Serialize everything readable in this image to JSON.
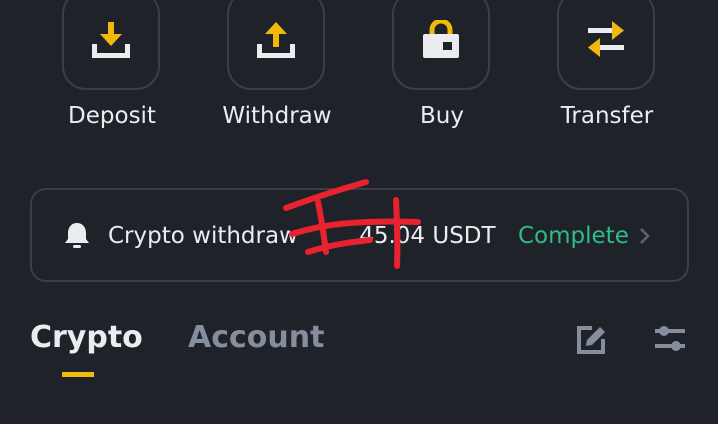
{
  "actions": [
    {
      "label": "Deposit",
      "icon": "deposit-icon"
    },
    {
      "label": "Withdraw",
      "icon": "withdraw-icon"
    },
    {
      "label": "Buy",
      "icon": "buy-icon"
    },
    {
      "label": "Transfer",
      "icon": "transfer-icon"
    }
  ],
  "notice": {
    "text_prefix": "Crypto withdraw",
    "text_suffix": "45.04 USDT",
    "status": "Complete",
    "icon": "bell-icon"
  },
  "tabs": [
    {
      "label": "Crypto",
      "active": true
    },
    {
      "label": "Account",
      "active": false
    }
  ],
  "toolbar": {
    "edit_icon": "edit-icon",
    "filter_icon": "filter-icon"
  },
  "colors": {
    "background": "#1f2329",
    "border": "#3a3f47",
    "accent": "#f0b90b",
    "success": "#2ebd85",
    "text_primary": "#eaecef",
    "text_secondary": "#848e9c",
    "redaction": "#e8222e"
  }
}
